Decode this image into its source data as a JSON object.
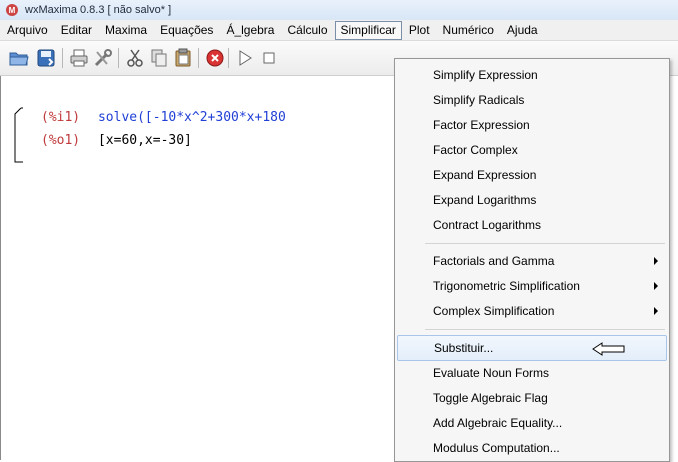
{
  "window": {
    "title": "wxMaxima 0.8.3 [ não salvo* ]",
    "app_icon": "M"
  },
  "menubar": {
    "items": [
      "Arquivo",
      "Editar",
      "Maxima",
      "Equações",
      "Á_lgebra",
      "Cálculo",
      "Simplificar",
      "Plot",
      "Numérico",
      "Ajuda"
    ],
    "active": "Simplificar"
  },
  "toolbar": {
    "icons": [
      "open-folder-icon",
      "save-icon",
      "print-icon",
      "preferences-icon",
      "cut-icon",
      "copy-icon",
      "paste-icon",
      "stop-icon",
      "play-icon",
      "stop-square-icon"
    ]
  },
  "worksheet": {
    "input_label": "(%i1)",
    "input_text": "solve([-10*x^2+300*x+180",
    "output_label": "(%o1)",
    "output_text": "[x=60,x=-30]"
  },
  "dropdown": {
    "groups": [
      [
        "Simplify Expression",
        "Simplify Radicals",
        "Factor Expression",
        "Factor Complex",
        "Expand Expression",
        "Expand Logarithms",
        "Contract Logarithms"
      ],
      [
        "Factorials and Gamma",
        "Trigonometric Simplification",
        "Complex Simplification"
      ],
      [
        "Substituir...",
        "Evaluate Noun Forms",
        "Toggle Algebraic Flag",
        "Add Algebraic Equality...",
        "Modulus Computation..."
      ]
    ],
    "submenu_items": [
      "Factorials and Gamma",
      "Trigonometric Simplification",
      "Complex Simplification"
    ],
    "highlighted": "Substituir..."
  }
}
